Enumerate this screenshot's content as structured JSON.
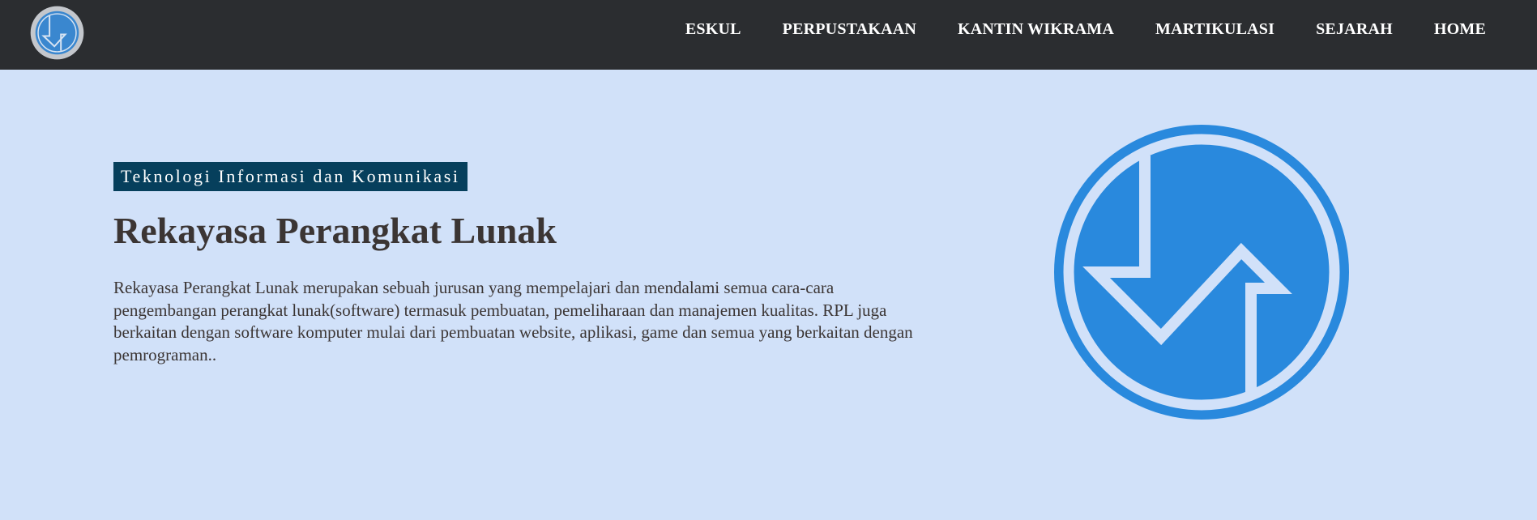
{
  "nav": {
    "logo_icon": "rpl-logo-icon",
    "items": [
      {
        "label": "ESKUL"
      },
      {
        "label": "PERPUSTAKAAN"
      },
      {
        "label": "KANTIN WIKRAMA"
      },
      {
        "label": "MARTIKULASI"
      },
      {
        "label": "SEJARAH"
      },
      {
        "label": "HOME"
      }
    ]
  },
  "hero": {
    "badge": "Teknologi Informasi dan Komunikasi",
    "title": "Rekayasa Perangkat Lunak",
    "description": "Rekayasa Perangkat Lunak merupakan sebuah jurusan yang mempelajari dan mendalami semua cara-cara pengembangan perangkat lunak(software) termasuk pembuatan, pemeliharaan dan manajemen kualitas. RPL juga berkaitan dengan software komputer mulai dari pembuatan website, aplikasi, game dan semua yang berkaitan dengan pemrograman..",
    "logo_icon": "rpl-logo-icon"
  },
  "colors": {
    "navbar_bg": "#2b2d30",
    "page_bg": "#d1e1f9",
    "badge_bg": "#063f5c",
    "logo_blue": "#2989dd",
    "text": "#3b3534"
  }
}
